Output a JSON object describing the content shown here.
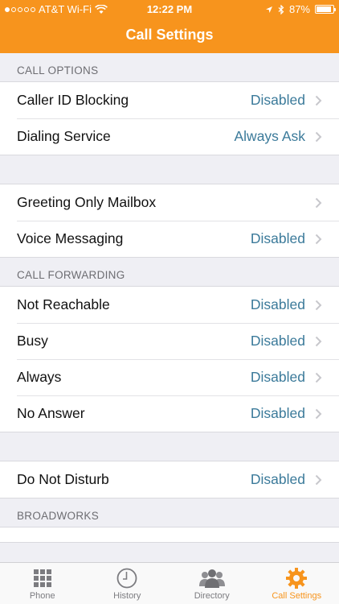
{
  "status": {
    "carrier": "AT&T Wi-Fi",
    "time": "12:22 PM",
    "battery": "87%"
  },
  "header": {
    "title": "Call Settings"
  },
  "sections": {
    "call_options": {
      "title": "CALL OPTIONS",
      "rows": [
        {
          "label": "Caller ID Blocking",
          "value": "Disabled"
        },
        {
          "label": "Dialing Service",
          "value": "Always Ask"
        }
      ]
    },
    "mail": {
      "rows": [
        {
          "label": "Greeting Only Mailbox",
          "value": ""
        },
        {
          "label": "Voice Messaging",
          "value": "Disabled"
        }
      ]
    },
    "call_forwarding": {
      "title": "CALL FORWARDING",
      "rows": [
        {
          "label": "Not Reachable",
          "value": "Disabled"
        },
        {
          "label": "Busy",
          "value": "Disabled"
        },
        {
          "label": "Always",
          "value": "Disabled"
        },
        {
          "label": "No Answer",
          "value": "Disabled"
        }
      ]
    },
    "dnd": {
      "rows": [
        {
          "label": "Do Not Disturb",
          "value": "Disabled"
        }
      ]
    },
    "broadworks": {
      "title": "BROADWORKS"
    }
  },
  "tabs": [
    {
      "label": "Phone",
      "icon": "keypad-icon"
    },
    {
      "label": "History",
      "icon": "clock-icon"
    },
    {
      "label": "Directory",
      "icon": "people-icon"
    },
    {
      "label": "Call Settings",
      "icon": "gear-icon"
    }
  ],
  "colors": {
    "accent": "#f7941d",
    "value": "#3b7a9a",
    "background": "#efeff4"
  }
}
